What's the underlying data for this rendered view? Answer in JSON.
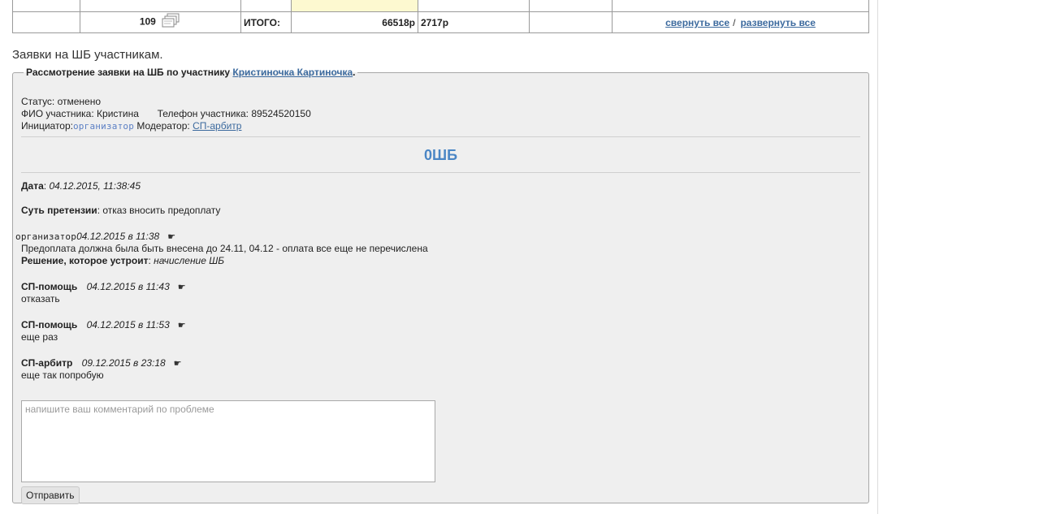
{
  "totals": {
    "count": "109",
    "total_label": "ИТОГО:",
    "sum": "66518р",
    "extra": "2717р",
    "collapse_label": "свернуть все",
    "separator": "/",
    "expand_label": "развернуть все"
  },
  "section_title": "Заявки на ШБ участникам.",
  "claim": {
    "legend_prefix": "Рассмотрение заявки на ШБ по участнику",
    "participant_link": "Кристиночка Картиночка",
    "legend_suffix": ".",
    "status_line": "Статус: отменено",
    "fio_label": "ФИО участника:",
    "fio_value": "Кристина",
    "phone_label": "Телефон участника:",
    "phone_value": "89524520150",
    "initiator_label": "Инициатор:",
    "initiator_value": "организатор",
    "moderator_label": "Модератор:",
    "moderator_value": "СП-арбитр",
    "title": "0ШБ",
    "date_label": "Дата",
    "date_value": "04.12.2015, 11:38:45",
    "essence_label": "Суть претензии",
    "essence_value": "отказ вносить предоплату",
    "comments": [
      {
        "author": "организатор",
        "datetime": "04.12.2015 в 11:38",
        "text": "Предоплата должна была быть внесена до 24.11, 04.12 - оплата все еще не перечислена",
        "solution_label": "Решение, которое устроит",
        "solution_value": "начисление ШБ"
      },
      {
        "author": "СП-помощь",
        "datetime": "04.12.2015 в 11:43",
        "text": "отказать"
      },
      {
        "author": "СП-помощь",
        "datetime": "04.12.2015 в 11:53",
        "text": "еще раз"
      },
      {
        "author": "СП-арбитр",
        "datetime": "09.12.2015 в 23:18",
        "text": "еще так попробую"
      }
    ],
    "reply_glyph": "☛",
    "comment_placeholder": "напишите ваш комментарий по проблеме",
    "submit_label": "Отправить"
  },
  "colors": {
    "link": "#3c6a9e",
    "title_blue": "#4a86c5",
    "panel_bg": "#efefef",
    "highlight_yellow": "#fdf9d0"
  }
}
